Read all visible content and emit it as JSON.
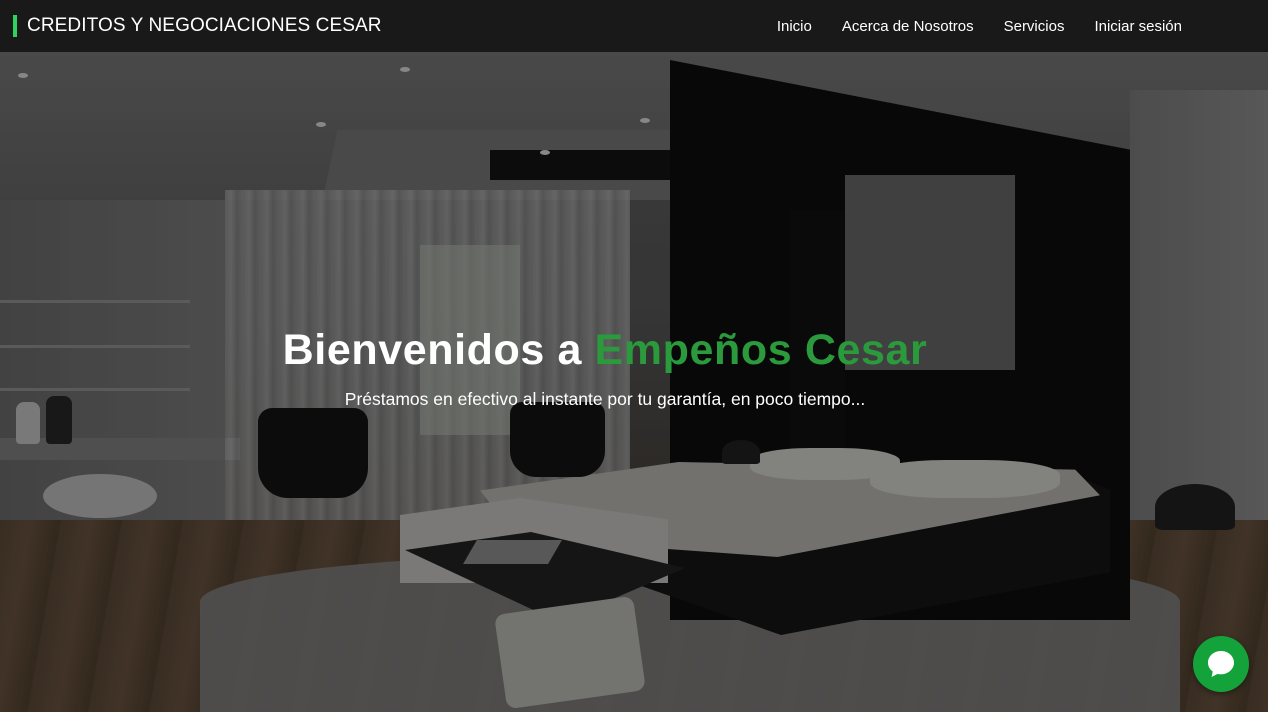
{
  "navbar": {
    "brand": "CREDITOS Y NEGOCIACIONES CESAR",
    "links": [
      {
        "label": "Inicio"
      },
      {
        "label": "Acerca de Nosotros"
      },
      {
        "label": "Servicios"
      },
      {
        "label": "Iniciar sesión"
      }
    ]
  },
  "hero": {
    "title_prefix": "Bienvenidos a ",
    "title_accent": "Empeños Cesar",
    "subtitle": "Préstamos en efectivo al instante por tu garantía, en poco tiempo..."
  },
  "chat_widget": {
    "icon": "chat-bubble-icon"
  },
  "colors": {
    "accent": "#2b9a3d",
    "brand_bar": "#2fd15f",
    "chat_button": "#14a33a",
    "navbar_bg": "#141414"
  }
}
